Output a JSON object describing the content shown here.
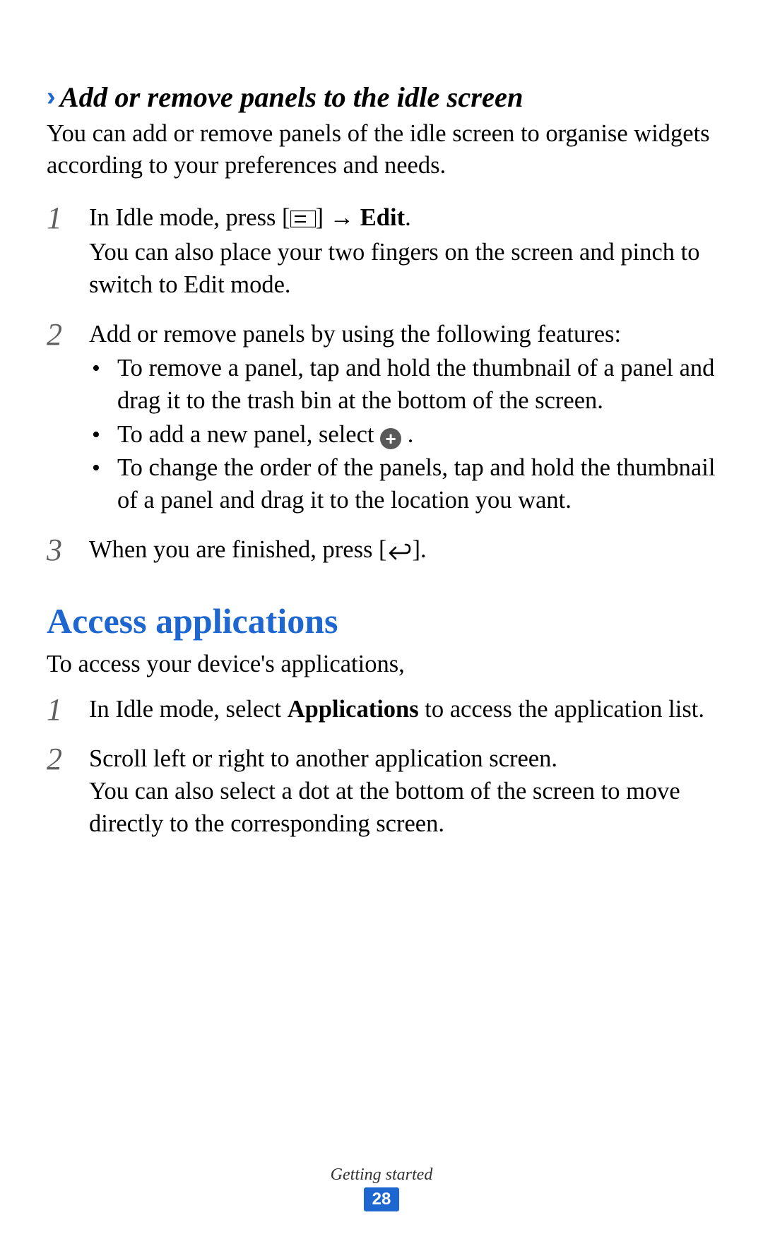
{
  "section1": {
    "heading": "Add or remove panels to the idle screen",
    "intro": "You can add or remove panels of the idle screen to organise widgets according to your preferences and needs.",
    "steps": [
      {
        "num": "1",
        "text_pre": "In Idle mode, press [",
        "text_mid": "] → ",
        "text_bold": "Edit",
        "text_post": ".",
        "sub": "You can also place your two fingers on the screen and pinch to switch to Edit mode."
      },
      {
        "num": "2",
        "text": "Add or remove panels by using the following features:",
        "bullets": [
          "To remove a panel, tap and hold the thumbnail of a panel and drag it to the trash bin at the bottom of the screen.",
          "To add a new panel, select ",
          "To change the order of the panels, tap and hold the thumbnail of a panel and drag it to the location you want."
        ]
      },
      {
        "num": "3",
        "text_pre": "When you are finished, press [",
        "text_post": "]."
      }
    ]
  },
  "section2": {
    "heading": "Access applications",
    "intro": "To access your device's applications,",
    "steps": [
      {
        "num": "1",
        "text_pre": "In Idle mode, select ",
        "text_bold": "Applications",
        "text_post": " to access the application list."
      },
      {
        "num": "2",
        "text": "Scroll left or right to another application screen.",
        "sub": "You can also select a dot at the bottom of the screen to move directly to the corresponding screen."
      }
    ]
  },
  "footer": {
    "section": "Getting started",
    "page": "28"
  }
}
